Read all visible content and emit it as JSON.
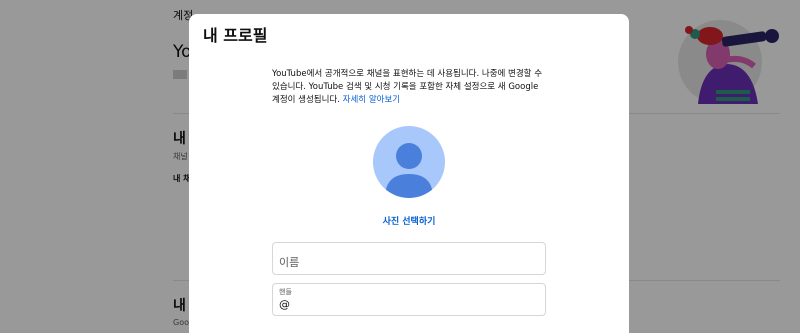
{
  "background": {
    "header_label": "계정",
    "title_partial": "Yo",
    "section1_title": "내 Y",
    "section1_sub": "채널",
    "section1_item": "내 채",
    "section2_title": "내 ",
    "section2_sub": "Goog"
  },
  "dialog": {
    "title": "내 프로필",
    "description": "YouTube에서 공개적으로 채널을 표현하는 데 사용됩니다. 나중에 변경할 수 있습니다. YouTube 검색 및 시청 기록을 포함한 자체 설정으로 새 Google 계정이 생성됩니다. ",
    "learn_more": "자세히 알아보기",
    "select_photo": "사진 선택하기",
    "name_placeholder": "이름",
    "handle_label": "핸들",
    "handle_placeholder": "@"
  },
  "colors": {
    "link": "#065fd4",
    "avatar_bg": "#a8c7fa",
    "avatar_fg": "#4a7fdb"
  },
  "icons": {
    "avatar": "default-person-icon",
    "illustration": "telescope-person-illustration"
  }
}
